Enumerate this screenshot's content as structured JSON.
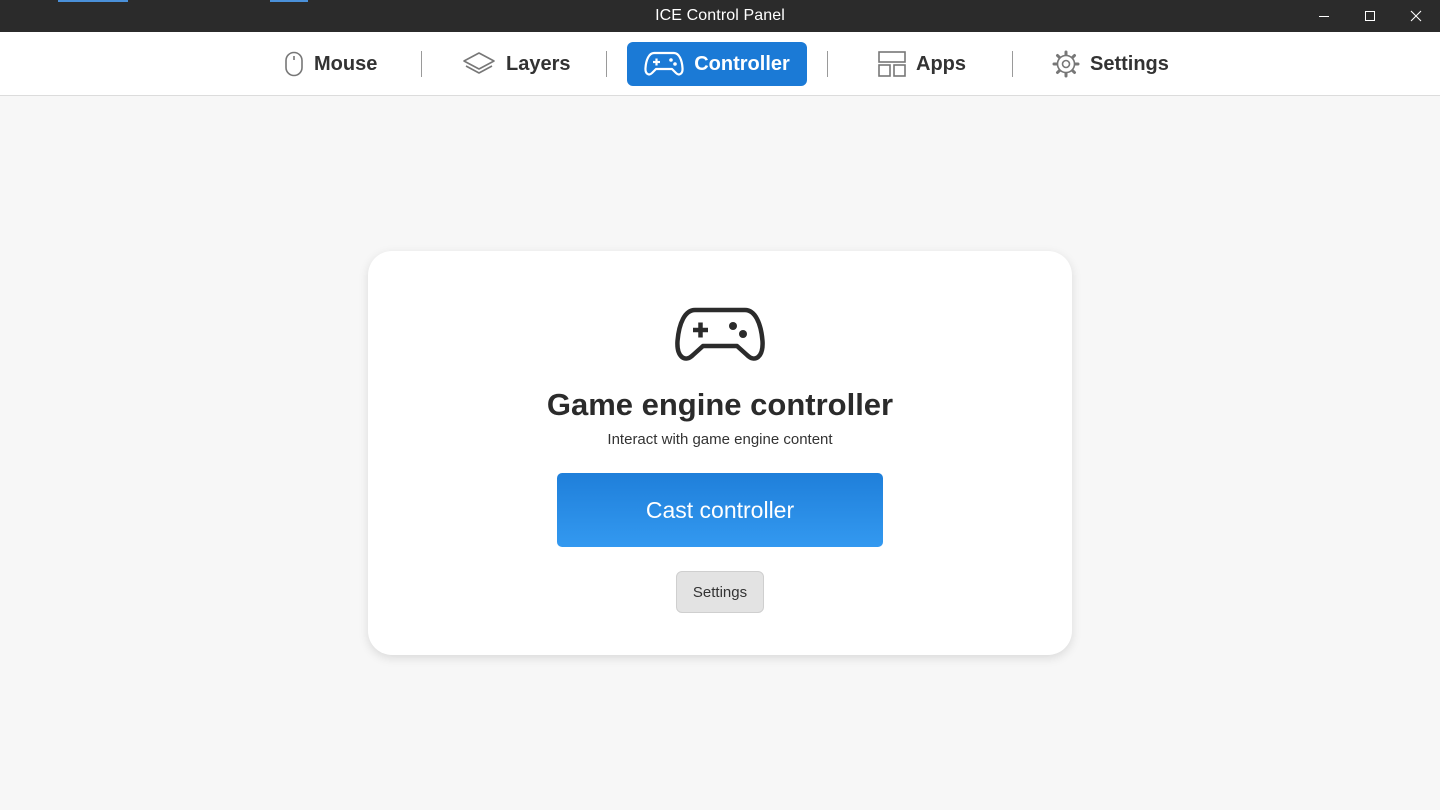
{
  "window": {
    "title": "ICE Control Panel",
    "controls": [
      "minimize-icon",
      "maximize-icon",
      "close-icon"
    ]
  },
  "nav": {
    "tabs": [
      {
        "label": "Mouse",
        "icon": "mouse-icon",
        "active": false
      },
      {
        "label": "Layers",
        "icon": "layers-icon",
        "active": false
      },
      {
        "label": "Controller",
        "icon": "gamepad-icon",
        "active": true
      },
      {
        "label": "Apps",
        "icon": "apps-grid-icon",
        "active": false
      },
      {
        "label": "Settings",
        "icon": "gear-icon",
        "active": false
      }
    ]
  },
  "card": {
    "icon": "gamepad-icon",
    "title": "Game engine controller",
    "subtitle": "Interact with game engine content",
    "primary_button": "Cast controller",
    "secondary_button": "Settings"
  },
  "colors": {
    "accent": "#1b7ad6",
    "titlebar": "#2b2b2b",
    "background": "#f7f7f7"
  }
}
